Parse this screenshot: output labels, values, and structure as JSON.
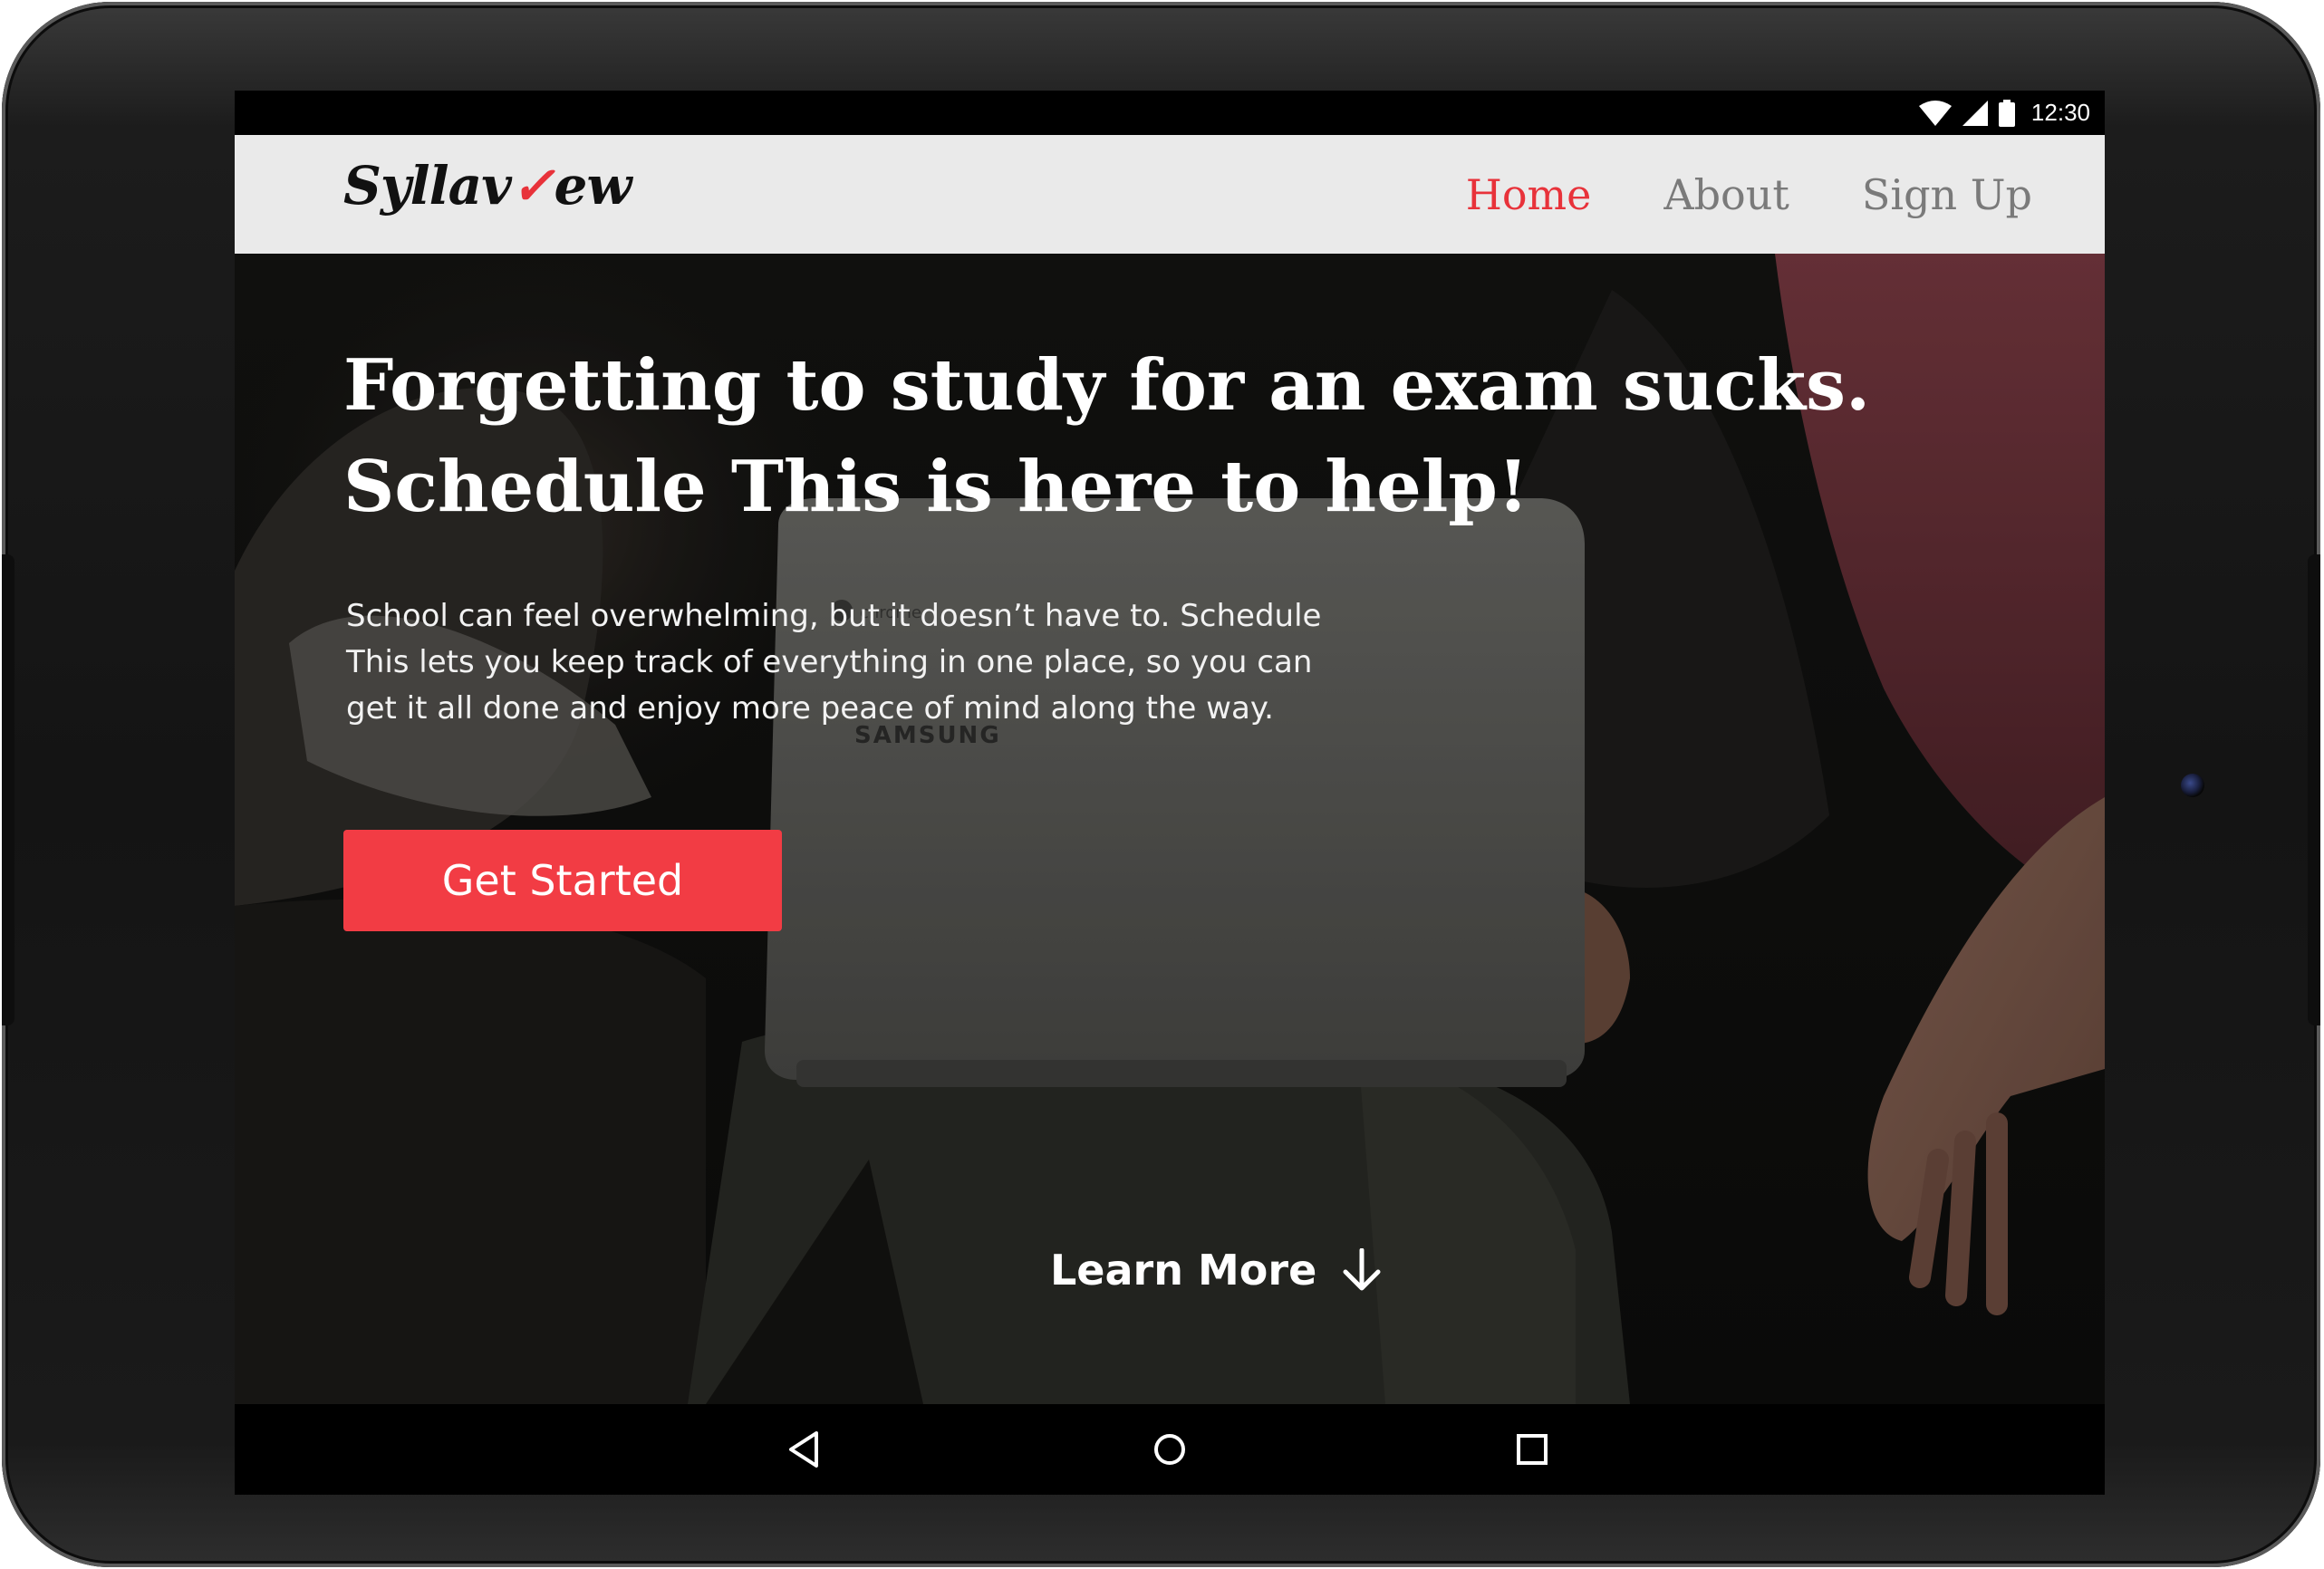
{
  "status_bar": {
    "time": "12:30",
    "icons": [
      "wifi-icon",
      "cell-signal-icon",
      "battery-icon"
    ]
  },
  "navbar": {
    "logo": {
      "prefix": "Syllav",
      "mark": "✓",
      "suffix": "ew"
    },
    "links": [
      {
        "label": "Home",
        "active": true
      },
      {
        "label": "About",
        "active": false
      },
      {
        "label": "Sign Up",
        "active": false
      }
    ]
  },
  "hero": {
    "headline_line1": "Forgetting to study for an exam sucks.",
    "headline_line2": "Schedule This is here to help!",
    "subtext": "School can feel overwhelming, but it doesn’t have to. Schedule This lets you keep track of everything in one place, so you can get it all done and enjoy more peace of mind along the way.",
    "cta_label": "Get Started",
    "learn_more_label": "Learn More",
    "laptop_brand": "SAMSUNG",
    "laptop_os": "chrome"
  },
  "system_nav": {
    "buttons": [
      "back-icon",
      "home-icon",
      "recents-icon"
    ]
  },
  "colors": {
    "accent": "#f23c44",
    "nav_active": "#e8323a",
    "navbar_bg": "#eaeaea"
  }
}
